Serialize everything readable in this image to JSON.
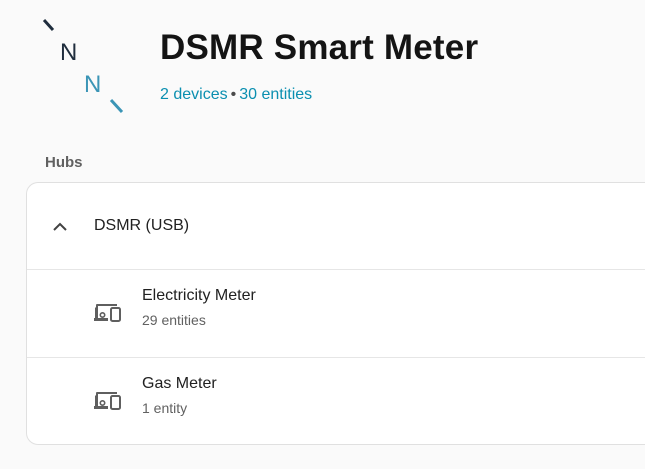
{
  "integration": {
    "title": "DSMR Smart Meter",
    "devices_link": "2 devices",
    "separator": "•",
    "entities_link": "30 entities"
  },
  "hubs": {
    "section_label": "Hubs",
    "hub_name": "DSMR (USB)",
    "devices": [
      {
        "name": "Electricity Meter",
        "entities": "29 entities"
      },
      {
        "name": "Gas Meter",
        "entities": "1 entity"
      }
    ]
  },
  "icons": {
    "logo": "nn-logo-icon",
    "expand": "chevron-up-icon",
    "device": "devices-icon"
  },
  "colors": {
    "link": "#0a8fb0",
    "logo_dark": "#1f2d3d",
    "logo_accent": "#3b95b6"
  }
}
